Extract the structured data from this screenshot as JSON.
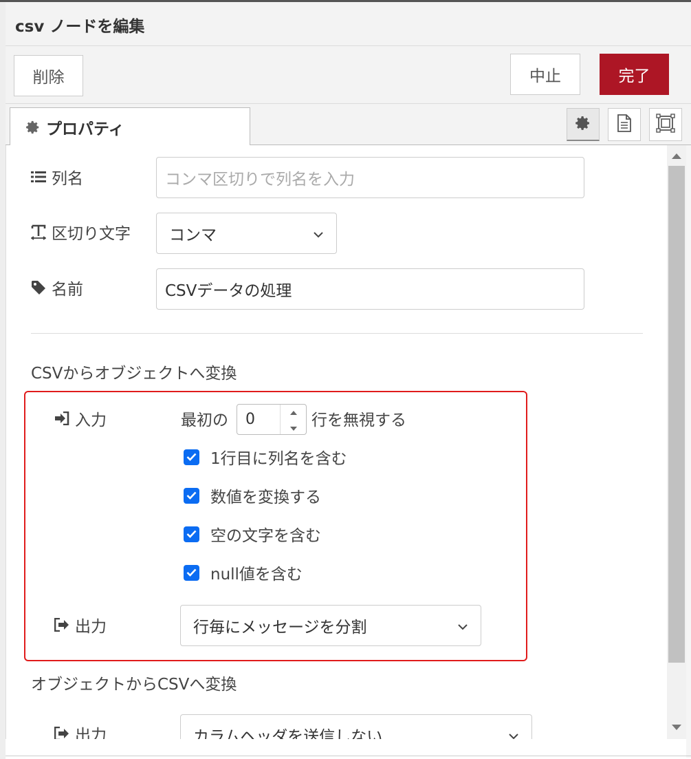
{
  "dialog": {
    "title": "csv ノードを編集"
  },
  "buttons": {
    "delete": "削除",
    "cancel": "中止",
    "done": "完了"
  },
  "tabs": {
    "properties": "プロパティ"
  },
  "fields": {
    "columns": {
      "label": "列名",
      "placeholder": "コンマ区切りで列名を入力"
    },
    "separator": {
      "label": "区切り文字",
      "value": "コンマ"
    },
    "name": {
      "label": "名前",
      "value": "CSVデータの処理"
    }
  },
  "csv_to_object": {
    "title": "CSVからオブジェクトへ変換",
    "input_label": "入力",
    "skip_prefix": "最初の",
    "skip_value": "0",
    "skip_suffix": "行を無視する",
    "checkboxes": [
      {
        "label": "1行目に列名を含む",
        "checked": true
      },
      {
        "label": "数値を変換する",
        "checked": true
      },
      {
        "label": "空の文字を含む",
        "checked": true
      },
      {
        "label": "null値を含む",
        "checked": true
      }
    ],
    "output_label": "出力",
    "output_value": "行毎にメッセージを分割"
  },
  "object_to_csv": {
    "title": "オブジェクトからCSVへ変換",
    "output_label": "出力",
    "output_value": "カラムヘッダを送信しない"
  },
  "colors": {
    "accent": "#ad1625",
    "checkbox": "#0b6cf2",
    "highlight": "#e01b1b"
  }
}
